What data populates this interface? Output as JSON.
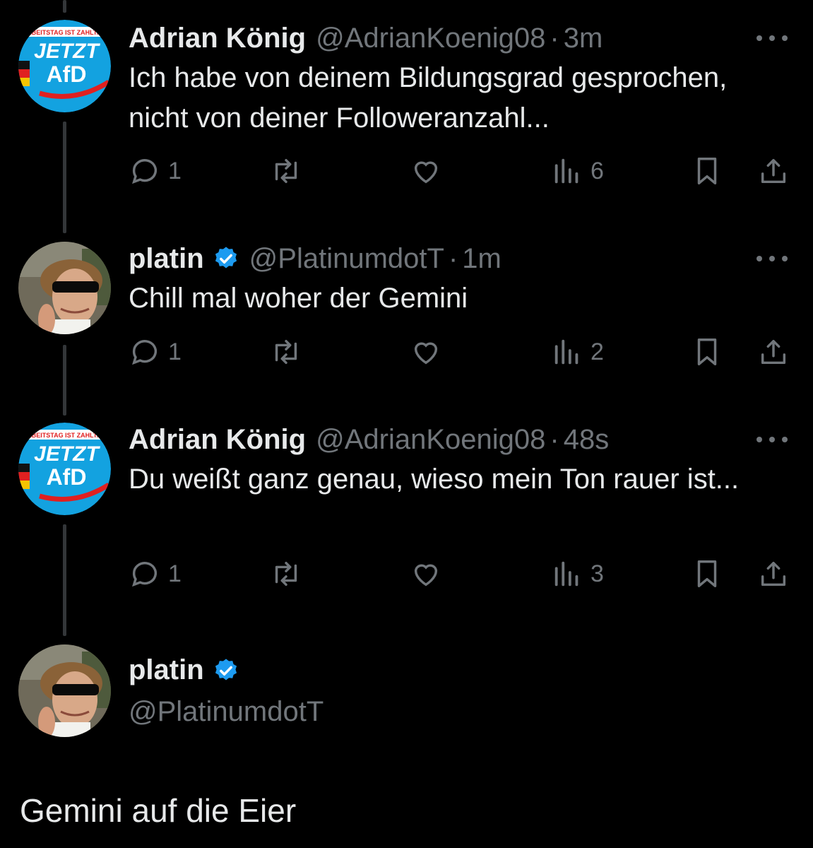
{
  "tweets": [
    {
      "name": "Adrian König",
      "handle": "@AdrianKoenig08",
      "sep": "·",
      "time": "3m",
      "text": "Ich habe von deinem Bildungsgrad gesprochen, nicht von deiner Followeranzahl...",
      "replies": "1",
      "views": "6",
      "avatar": {
        "line1": "JETZT",
        "line2": "AfD",
        "banner": "ARBEITSTAG IST ZAHLTAG"
      }
    },
    {
      "name": "platin",
      "handle": "@PlatinumdotT",
      "sep": "·",
      "time": "1m",
      "text": "Chill mal woher der Gemini",
      "replies": "1",
      "views": "2"
    },
    {
      "name": "Adrian König",
      "handle": "@AdrianKoenig08",
      "sep": "·",
      "time": "48s",
      "text": "Du weißt ganz genau, wieso mein Ton rauer ist...",
      "replies": "1",
      "views": "3",
      "avatar": {
        "line1": "JETZT",
        "line2": "AfD",
        "banner": "ARBEITSTAG IST ZAHLTAG"
      }
    }
  ],
  "main": {
    "name": "platin",
    "handle": "@PlatinumdotT",
    "text": "Gemini auf die Eier"
  },
  "colors": {
    "background": "#000000",
    "text": "#e7e9ea",
    "muted": "#71767b",
    "verified": "#1d9bf0",
    "thread_line": "#333639"
  }
}
